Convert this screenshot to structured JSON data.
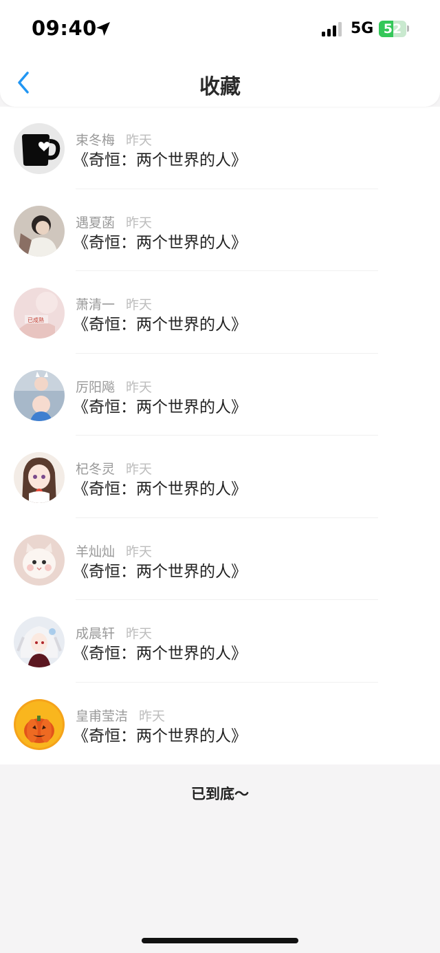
{
  "status_bar": {
    "time": "09:40",
    "network": "5G",
    "battery": "52",
    "battery_level": 0.52,
    "battery_color": "#34c759"
  },
  "header": {
    "title": "收藏",
    "back_icon": "chevron-left-icon",
    "accent_color": "#2196f3"
  },
  "items": [
    {
      "name": "束冬梅",
      "time": "昨天",
      "title": "《奇恒：两个世界的人》",
      "avatar": "black-mug-heart"
    },
    {
      "name": "遇夏菡",
      "time": "昨天",
      "title": "《奇恒：两个世界的人》",
      "avatar": "person-photo"
    },
    {
      "name": "萧清一",
      "time": "昨天",
      "title": "《奇恒：两个世界的人》",
      "avatar": "pink-photo"
    },
    {
      "name": "厉阳飚",
      "time": "昨天",
      "title": "《奇恒：两个世界的人》",
      "avatar": "baby-photo"
    },
    {
      "name": "杞冬灵",
      "time": "昨天",
      "title": "《奇恒：两个世界的人》",
      "avatar": "anime-girl"
    },
    {
      "name": "羊灿灿",
      "time": "昨天",
      "title": "《奇恒：两个世界的人》",
      "avatar": "white-kitten"
    },
    {
      "name": "成晨轩",
      "time": "昨天",
      "title": "《奇恒：两个世界的人》",
      "avatar": "anime-character"
    },
    {
      "name": "皇甫莹洁",
      "time": "昨天",
      "title": "《奇恒：两个世界的人》",
      "avatar": "pumpkin"
    }
  ],
  "footer": {
    "end_text": "已到底～"
  }
}
